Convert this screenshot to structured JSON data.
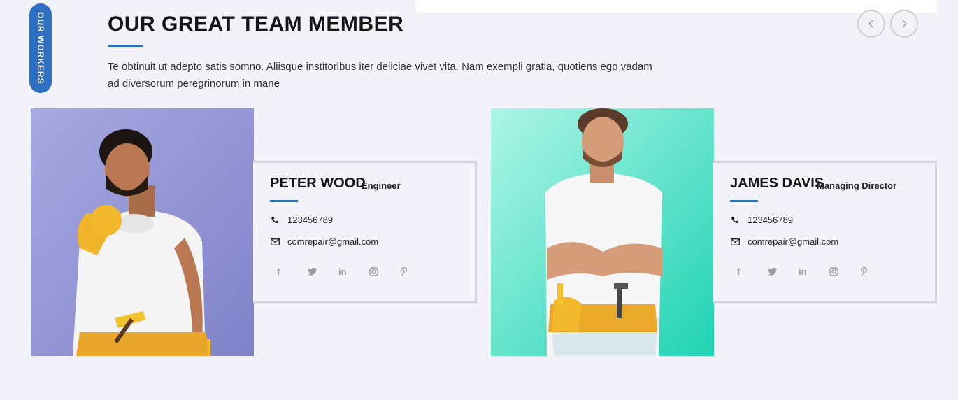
{
  "side_label": "OUR WORKERS",
  "section": {
    "title": "OUR GREAT TEAM MEMBER",
    "description": "Te obtinuit ut adepto satis somno. Aliisque institoribus iter deliciae vivet vita. Nam exempli gratia, quotiens ego vadam ad diversorum peregrinorum in mane"
  },
  "nav": {
    "prev_icon": "chevron-left-icon",
    "next_icon": "chevron-right-icon"
  },
  "members": [
    {
      "name": "PETER WOOD",
      "role": "Engineer",
      "phone": "123456789",
      "email": "comrepair@gmail.com",
      "photo_bg": "#9a9cd8"
    },
    {
      "name": "JAMES DAVIS",
      "role": "Managing Director",
      "phone": "123456789",
      "email": "comrepair@gmail.com",
      "photo_bg": "#4fe0c4"
    }
  ],
  "social_icons": [
    "facebook-icon",
    "twitter-icon",
    "linkedin-icon",
    "instagram-icon",
    "pinterest-icon"
  ],
  "colors": {
    "accent": "#2f6fc2",
    "background": "#f3f2f8"
  }
}
